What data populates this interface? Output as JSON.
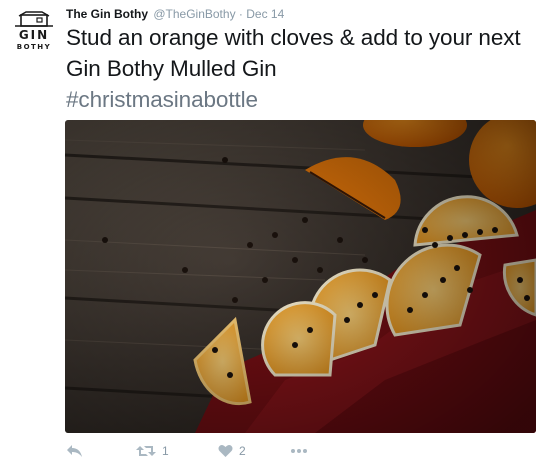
{
  "account": {
    "display_name": "The Gin Bothy",
    "handle": "@TheGinBothy",
    "separator": "·",
    "date": "Dec 14",
    "avatar_logo_line1": "GIN",
    "avatar_logo_line2": "BOTHY"
  },
  "tweet": {
    "text": "Stud an orange with cloves & add to your next Gin Bothy Mulled Gin",
    "hashtag": "#christmasinabottle"
  },
  "media": {
    "icon": "photo-orange-cloves"
  },
  "actions": {
    "reply_icon": "reply-icon",
    "retweet_icon": "retweet-icon",
    "retweet_count": "1",
    "like_icon": "heart-icon",
    "like_count": "2",
    "more_icon": "more-icon"
  },
  "colors": {
    "text": "#14171a",
    "muted": "#8899a6",
    "icon": "#aab8c2",
    "hashtag": "#6b7783"
  }
}
